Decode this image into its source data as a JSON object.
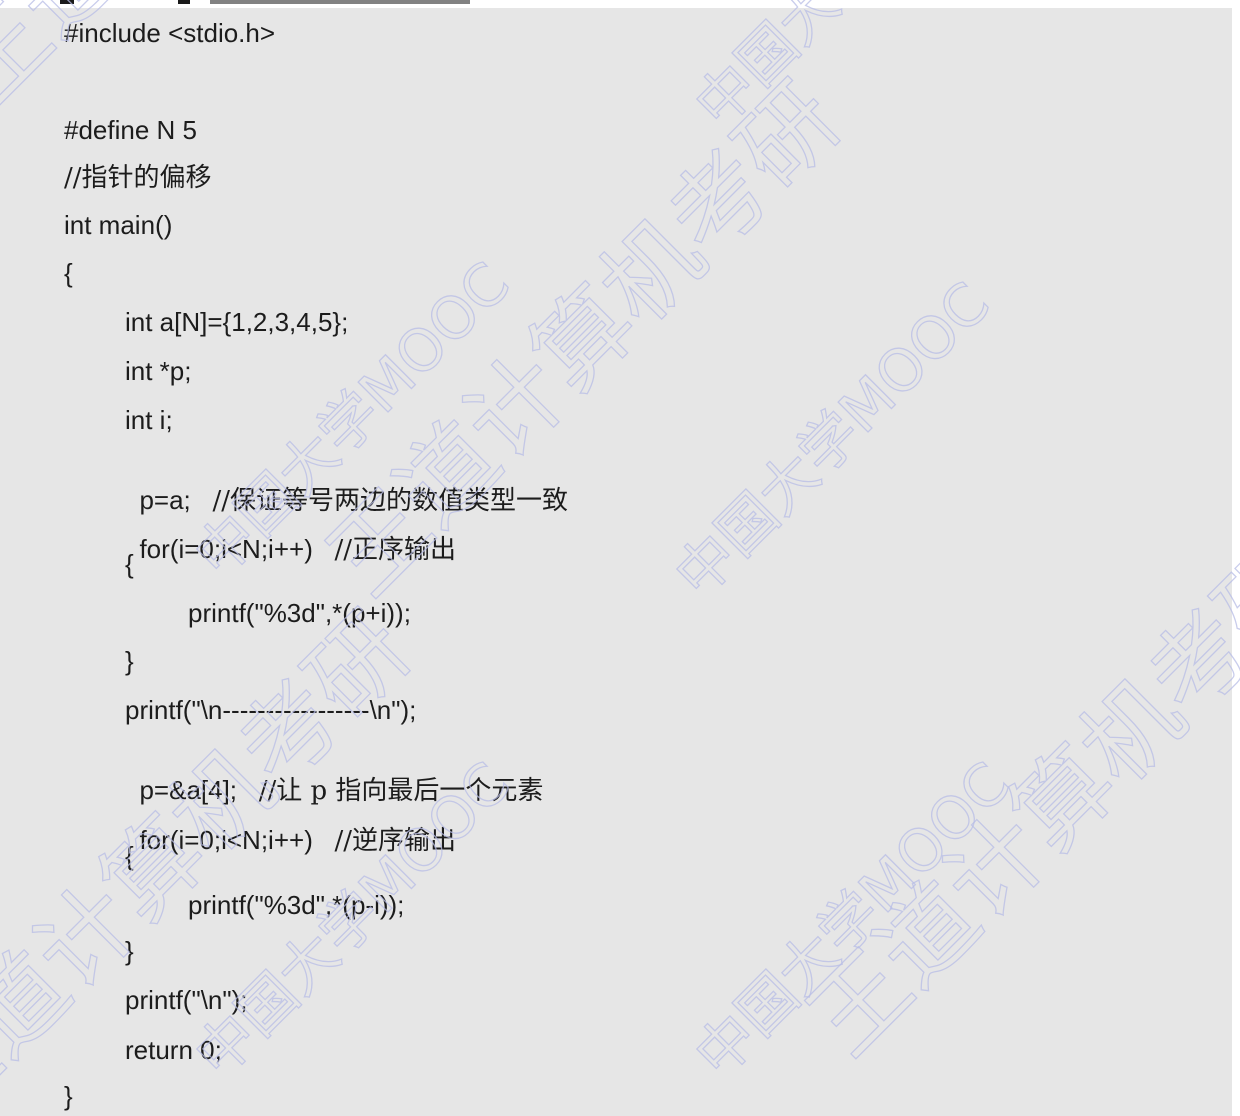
{
  "code": {
    "lines": [
      {
        "text": "#include <stdio.h>"
      },
      {
        "text": ""
      },
      {
        "text": "#define N 5"
      },
      {
        "text": "//指针的偏移"
      },
      {
        "text": "int main()"
      },
      {
        "text": "{"
      },
      {
        "text": "int a[N]={1,2,3,4,5};"
      },
      {
        "text": "int *p;"
      },
      {
        "text": "int i;"
      },
      {
        "code": "p=a;",
        "comment": "//保证等号两边的数值类型一致"
      },
      {
        "code": "for(i=0;i<N;i++)",
        "comment": "//正序输出"
      },
      {
        "text": "{"
      },
      {
        "text": "printf(\"%3d\",*(p+i));"
      },
      {
        "text": "}"
      },
      {
        "text": "printf(\"\\n-----------------\\n\");"
      },
      {
        "code": "p=&a[4];",
        "comment": "//让 p 指向最后一个元素"
      },
      {
        "code": "for(i=0;i<N;i++)",
        "comment": "//逆序输出"
      },
      {
        "text": "{"
      },
      {
        "text": "printf(\"%3d\",*(p-i));"
      },
      {
        "text": "}"
      },
      {
        "text": "printf(\"\\n\");"
      },
      {
        "text": "return 0;"
      },
      {
        "text": "}"
      }
    ]
  },
  "watermarks": {
    "wangdao": "王道计算机考研",
    "university": "中国大学MOOC"
  },
  "colors": {
    "panel": "#e6e6e6",
    "text": "#1c1c1c",
    "watermark": "#b8bde6"
  }
}
